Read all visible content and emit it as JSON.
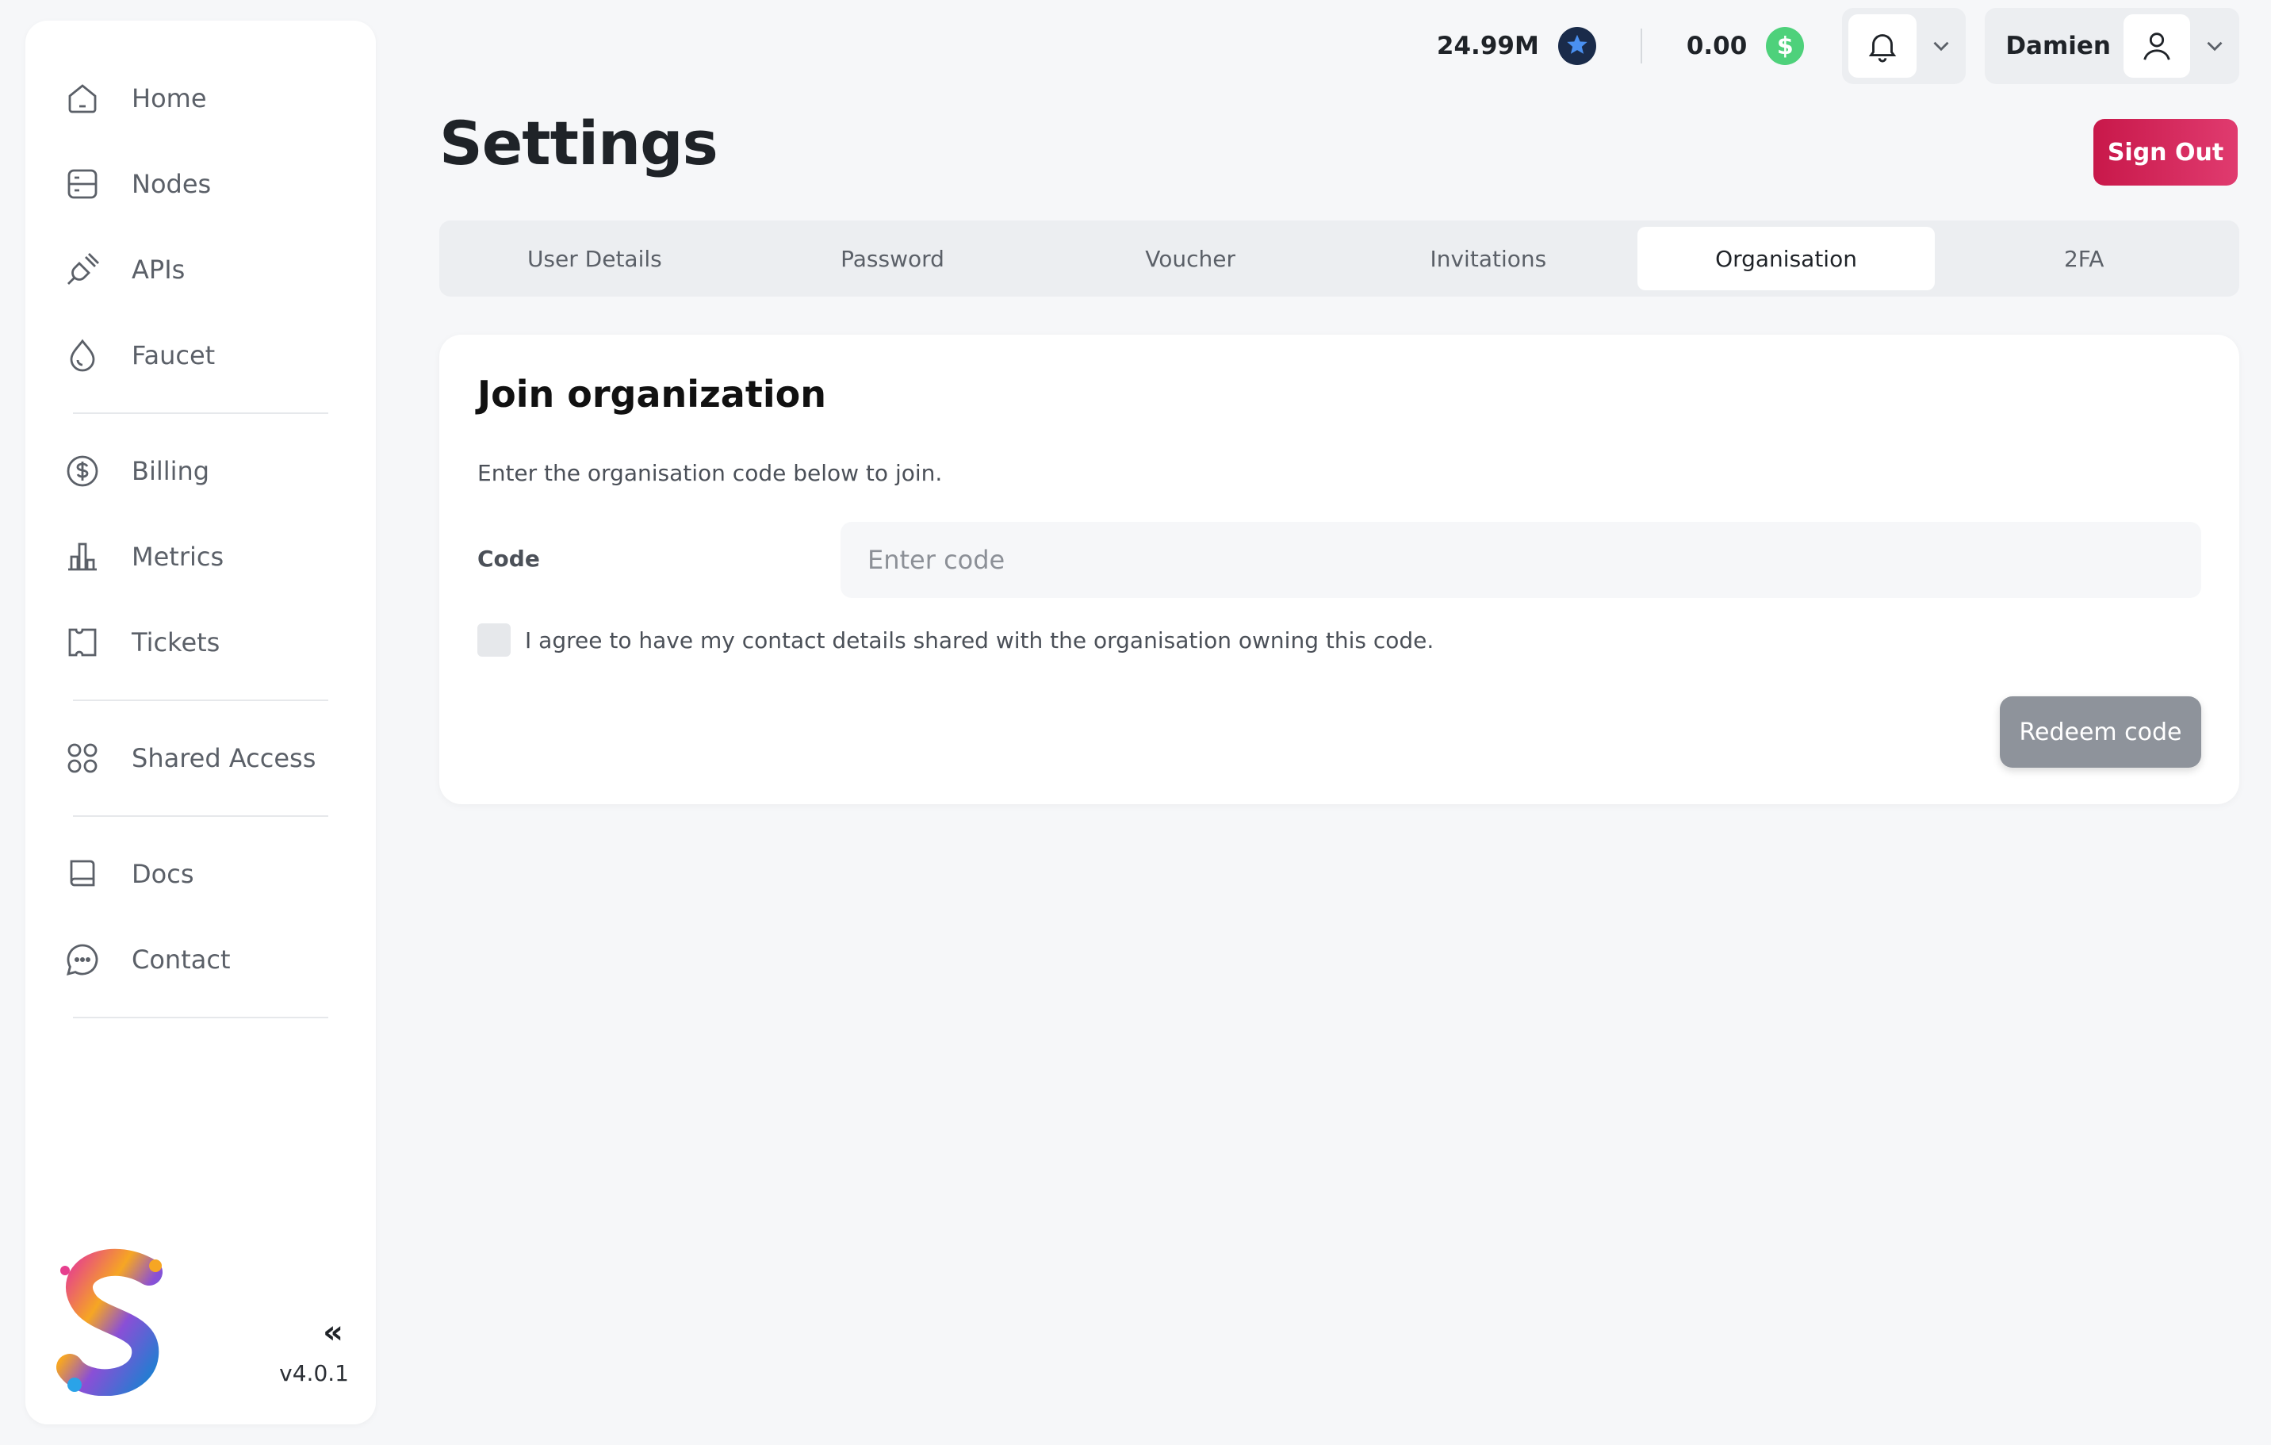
{
  "sidebar": {
    "items": [
      {
        "label": "Home"
      },
      {
        "label": "Nodes"
      },
      {
        "label": "APIs"
      },
      {
        "label": "Faucet"
      },
      {
        "label": "Billing"
      },
      {
        "label": "Metrics"
      },
      {
        "label": "Tickets"
      },
      {
        "label": "Shared Access"
      },
      {
        "label": "Docs"
      },
      {
        "label": "Contact"
      }
    ],
    "collapse_glyph": "«",
    "version": "v4.0.1"
  },
  "topbar": {
    "credits": "24.99M",
    "balance": "0.00",
    "balance_symbol": "$",
    "user_name": "Damien"
  },
  "page": {
    "title": "Settings",
    "sign_out_label": "Sign Out"
  },
  "tabs": [
    {
      "label": "User Details"
    },
    {
      "label": "Password"
    },
    {
      "label": "Voucher"
    },
    {
      "label": "Invitations"
    },
    {
      "label": "Organisation"
    },
    {
      "label": "2FA"
    }
  ],
  "card": {
    "title": "Join organization",
    "description": "Enter the organisation code below to join.",
    "code_label": "Code",
    "code_placeholder": "Enter code",
    "code_value": "",
    "agree_text": "I agree to have my contact details shared with the organisation owning this code.",
    "redeem_label": "Redeem code"
  },
  "colors": {
    "accent": "#c8184a",
    "coin_blue": "#1a2b4a",
    "coin_green": "#4ed17b",
    "disabled_button": "#8e939b"
  }
}
